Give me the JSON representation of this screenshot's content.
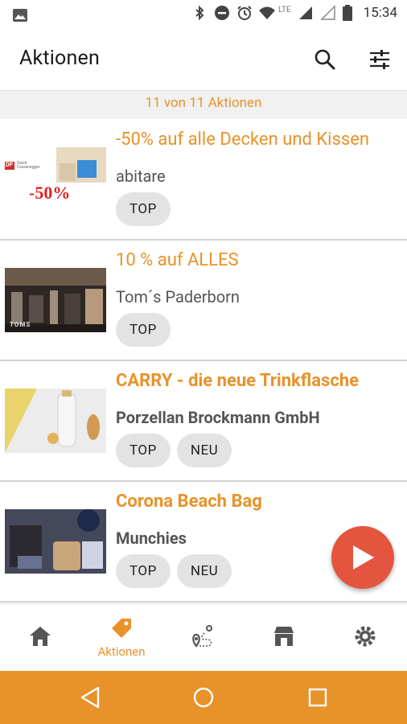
{
  "status_bar": {
    "time": "15:34",
    "network": "LTE",
    "icons": [
      "image-icon",
      "bluetooth-icon",
      "do-not-disturb-icon",
      "alarm-icon",
      "wifi-icon",
      "signal-icon",
      "signal-empty-icon",
      "battery-icon"
    ]
  },
  "app_bar": {
    "title": "Aktionen",
    "actions": [
      "search-icon",
      "filter-sliders-icon"
    ]
  },
  "count_text": "11 von 11 Aktionen",
  "deals": [
    {
      "title": "-50% auf alle Decken und Kissen",
      "shop": "abitare",
      "tags": [
        "TOP"
      ],
      "thumb_label": "-50%",
      "thumb_badge": "DP",
      "thumb_caption": "David Fussenegger"
    },
    {
      "title": "10 % auf ALLES",
      "shop": "Tom´s Paderborn",
      "tags": [
        "TOP"
      ],
      "thumb_label": "TOMS"
    },
    {
      "title": "CARRY - die neue Trinkflasche",
      "shop": "Porzellan Brockmann GmbH",
      "tags": [
        "TOP",
        "NEU"
      ]
    },
    {
      "title": "Corona Beach Bag",
      "shop": "Munchies",
      "tags": [
        "TOP",
        "NEU"
      ]
    }
  ],
  "bottom_nav": {
    "items": [
      {
        "icon": "home-icon",
        "label": ""
      },
      {
        "icon": "tag-icon",
        "label": "Aktionen"
      },
      {
        "icon": "route-map-icon",
        "label": ""
      },
      {
        "icon": "store-icon",
        "label": ""
      },
      {
        "icon": "settings-icon",
        "label": ""
      }
    ],
    "active_index": 1
  },
  "colors": {
    "accent": "#e8922a",
    "fab": "#e4553f",
    "tag_bg": "#e3e3e3"
  }
}
